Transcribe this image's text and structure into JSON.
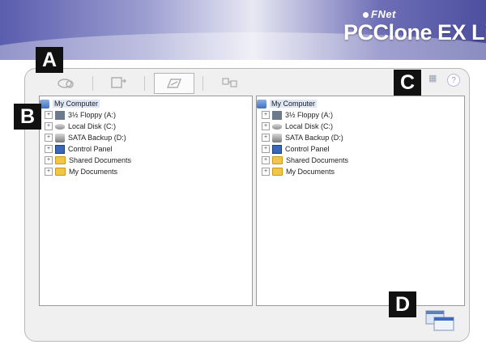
{
  "header": {
    "brand_small": "FNet",
    "brand_big": "PCClone EX Lite"
  },
  "toolbar": {
    "buttons": [
      {
        "icon": "backup-icon"
      },
      {
        "icon": "restore-icon"
      },
      {
        "icon": "sync-icon",
        "active": true
      },
      {
        "icon": "settings-icon"
      }
    ],
    "right_icons": [
      "windows-icon",
      "help-icon"
    ],
    "help_glyph": "?"
  },
  "callouts": {
    "a": "A",
    "b": "B",
    "c": "C",
    "d": "D"
  },
  "left_tree": {
    "root": "My Computer",
    "items": [
      "3½ Floppy (A:)",
      "Local Disk (C:)",
      "SATA Backup (D:)",
      "Control Panel",
      "Shared Documents",
      "My Documents"
    ]
  },
  "right_tree": {
    "root": "My Computer",
    "items": [
      "3½ Floppy (A:)",
      "Local Disk (C:)",
      "SATA Backup (D:)",
      "Control Panel",
      "Shared Documents",
      "My Documents"
    ]
  },
  "colors": {
    "banner_dark": "#5a5cae",
    "panel_bg": "#f0f0f0"
  }
}
